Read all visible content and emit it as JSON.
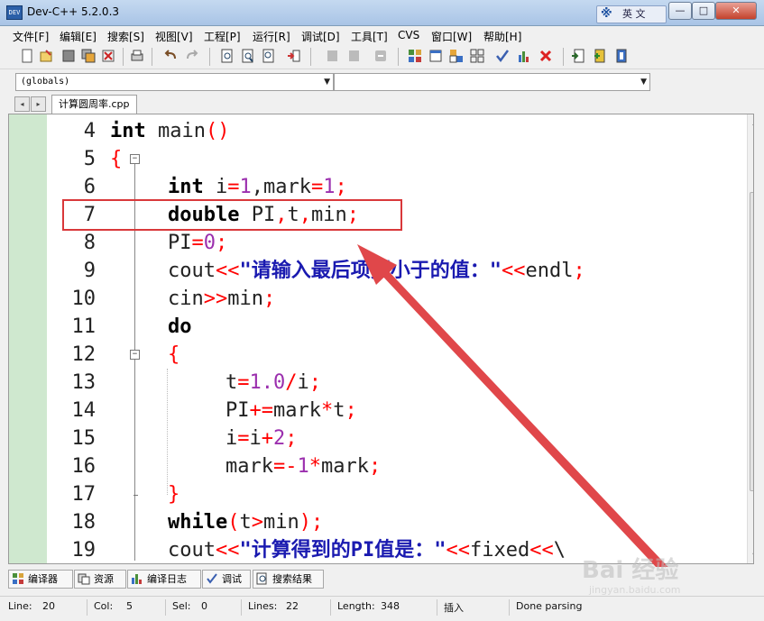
{
  "window": {
    "title": "Dev-C++ 5.2.0.3",
    "app_icon_text": "DEV",
    "ime_indicator": "英 文",
    "controls": {
      "minimize": "—",
      "maximize": "□",
      "close": "✕"
    }
  },
  "menu": {
    "items": [
      "文件[F]",
      "编辑[E]",
      "搜索[S]",
      "视图[V]",
      "工程[P]",
      "运行[R]",
      "调试[D]",
      "工具[T]",
      "CVS",
      "窗口[W]",
      "帮助[H]"
    ]
  },
  "toolbar": {
    "icons": [
      "new-file-icon",
      "open-file-icon",
      "save-icon",
      "save-all-icon",
      "close-file-icon",
      "print-icon",
      "undo-icon",
      "redo-icon",
      "find-icon",
      "find-replace-icon",
      "find-next-icon",
      "goto-line-icon",
      "indent-icon",
      "unindent-icon",
      "toggle-comment-icon",
      "compile-icon",
      "run-icon",
      "compile-run-icon",
      "rebuild-icon",
      "syntax-check-icon",
      "profile-icon",
      "stop-icon",
      "new-project-icon",
      "add-file-icon",
      "remove-file-icon"
    ]
  },
  "selectors": {
    "scope": "(globals)",
    "member": ""
  },
  "tabs": {
    "active_file": "计算圆周率.cpp",
    "nav_left": "◂",
    "nav_right": "▸"
  },
  "editor": {
    "fold_open": "−",
    "lines": [
      {
        "num": "4"
      },
      {
        "num": "5"
      },
      {
        "num": "6"
      },
      {
        "num": "7"
      },
      {
        "num": "8"
      },
      {
        "num": "9"
      },
      {
        "num": "10"
      },
      {
        "num": "11"
      },
      {
        "num": "12"
      },
      {
        "num": "13"
      },
      {
        "num": "14"
      },
      {
        "num": "15"
      },
      {
        "num": "16"
      },
      {
        "num": "17"
      },
      {
        "num": "18"
      },
      {
        "num": "19"
      }
    ],
    "code": {
      "l4": {
        "kw": "int",
        "rest": " main",
        "p": "()"
      },
      "l5": {
        "brace": "{"
      },
      "l6": {
        "kw": "int",
        "a": " i",
        "eq": "=",
        "n1": "1",
        "c": ",mark",
        "eq2": "=",
        "n2": "1",
        "semi": ";"
      },
      "l7": {
        "kw": "double",
        "a": " PI",
        "c1": ",",
        "b": "t",
        "c2": ",",
        "d": "min",
        "semi": ";"
      },
      "l8": {
        "a": "PI",
        "eq": "=",
        "n": "0",
        "semi": ";"
      },
      "l9": {
        "a": "cout",
        "op": "<<",
        "s": "\"请输入最后项要小于的值：\"",
        "op2": "<<",
        "b": "endl",
        "semi": ";"
      },
      "l10": {
        "a": "cin",
        "op": ">>",
        "b": "min",
        "semi": ";"
      },
      "l11": {
        "kw": "do"
      },
      "l12": {
        "brace": "{"
      },
      "l13": {
        "a": "t",
        "eq": "=",
        "n": "1.0",
        "op": "/",
        "b": "i",
        "semi": ";"
      },
      "l14": {
        "a": "PI",
        "op": "+=",
        "b": "mark",
        "op2": "*",
        "c": "t",
        "semi": ";"
      },
      "l15": {
        "a": "i",
        "eq": "=",
        "b": "i",
        "op": "+",
        "n": "2",
        "semi": ";"
      },
      "l16": {
        "a": "mark",
        "eq": "=-",
        "n": "1",
        "op": "*",
        "b": "mark",
        "semi": ";"
      },
      "l17": {
        "brace": "}"
      },
      "l18": {
        "kw": "while",
        "p1": "(",
        "a": "t",
        "op": ">",
        "b": "min",
        "p2": ")",
        "semi": ";"
      },
      "l19": {
        "a": "cout",
        "op": "<<",
        "s": "\"计算得到的PI值是：\"",
        "op2": "<<",
        "b": "fixed",
        "op3": "<<",
        "c": "\\"
      }
    }
  },
  "bottom_tabs": [
    {
      "label": "编译器"
    },
    {
      "label": "资源"
    },
    {
      "label": "编译日志"
    },
    {
      "label": "调试"
    },
    {
      "label": "搜索结果"
    }
  ],
  "status": {
    "line_label": "Line:",
    "line": "20",
    "col_label": "Col:",
    "col": "5",
    "sel_label": "Sel:",
    "sel": "0",
    "lines_label": "Lines:",
    "lines": "22",
    "length_label": "Length:",
    "length": "348",
    "mode": "插入",
    "message": "Done parsing"
  },
  "watermark": {
    "logo": "Bai 经验",
    "url": "jingyan.baidu.com"
  },
  "colors": {
    "gutter": "#cfe8cf",
    "keyword": "#000000",
    "operator": "#ff0000",
    "number": "#9b2fae",
    "string": "#1a1ab0",
    "annotation": "#d9383a"
  }
}
